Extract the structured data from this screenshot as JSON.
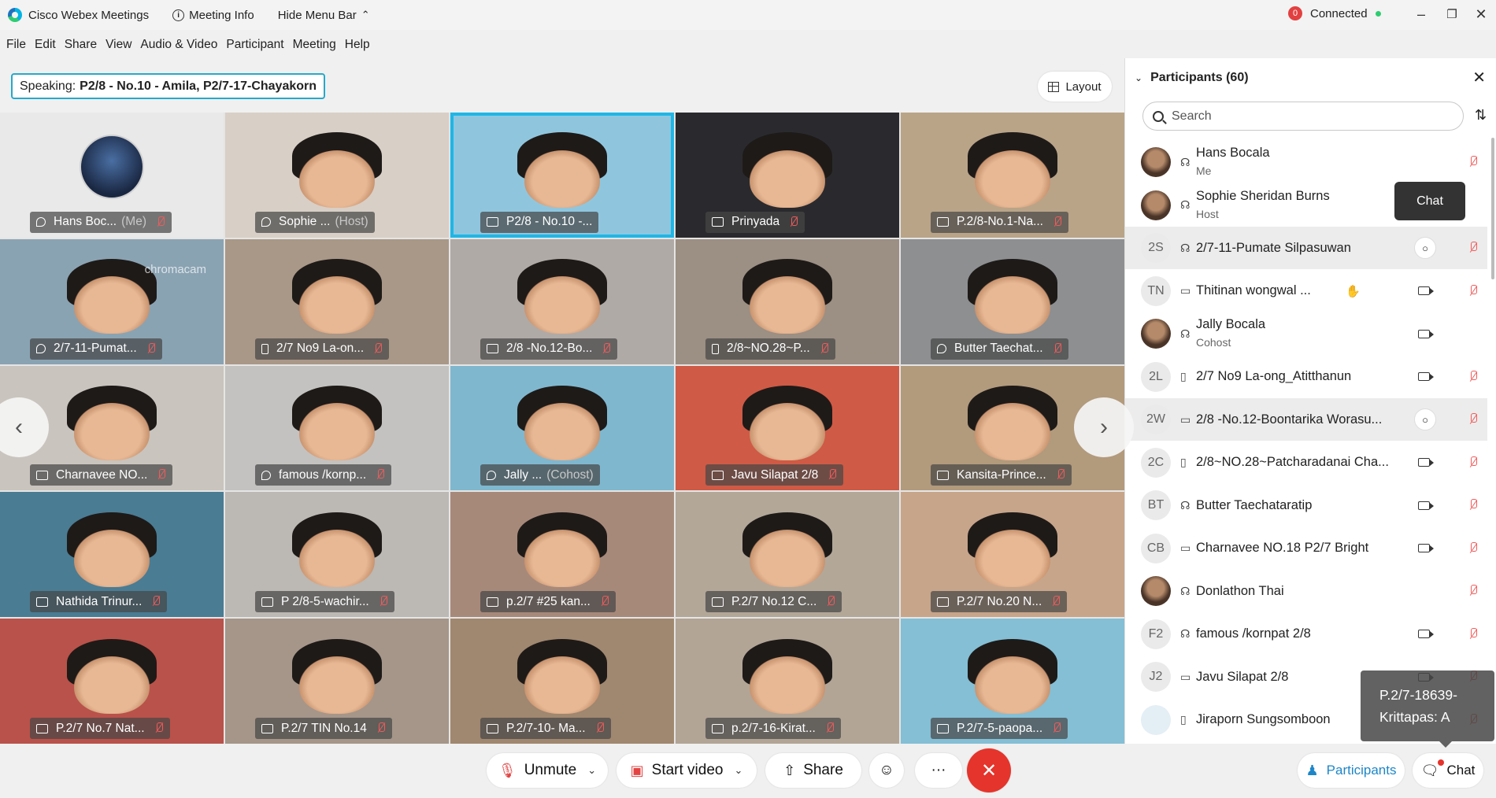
{
  "titlebar": {
    "app_name": "Cisco Webex Meetings",
    "meeting_info": "Meeting Info",
    "hide_menu": "Hide Menu Bar",
    "status_badge": "0",
    "status_text": "Connected"
  },
  "menu": [
    "File",
    "Edit",
    "Share",
    "View",
    "Audio & Video",
    "Participant",
    "Meeting",
    "Help"
  ],
  "speaking": {
    "prefix": "Speaking:",
    "names": "P2/8 - No.10 - Amila, P2/7-17-Chayakorn"
  },
  "layout_label": "Layout",
  "tiles": [
    {
      "label": "Hans Boc...",
      "role": "(Me)",
      "icon": "audio",
      "muted": true,
      "bg": "#e9e9e9",
      "avatar": true
    },
    {
      "label": "Sophie ...",
      "role": "(Host)",
      "icon": "audio",
      "muted": false,
      "bg": "#d8cfc6"
    },
    {
      "label": "P2/8 - No.10 -...",
      "role": "",
      "icon": "video",
      "muted": false,
      "bg": "#8fc6de",
      "active": true
    },
    {
      "label": "Prinyada",
      "role": "",
      "icon": "video",
      "muted": true,
      "bg": "#2a2a2e"
    },
    {
      "label": "P.2/8-No.1-Na...",
      "role": "",
      "icon": "video",
      "muted": true,
      "bg": "#b9a488"
    },
    {
      "label": "2/7-11-Pumat...",
      "role": "",
      "icon": "audio",
      "muted": true,
      "bg": "#8aa3b3",
      "cc": "chromacam"
    },
    {
      "label": "2/7 No9 La-on...",
      "role": "",
      "icon": "phone",
      "muted": true,
      "bg": "#a99787"
    },
    {
      "label": "2/8 -No.12-Bo...",
      "role": "",
      "icon": "video",
      "muted": true,
      "bg": "#b0aaa6"
    },
    {
      "label": "2/8~NO.28~P...",
      "role": "",
      "icon": "phone",
      "muted": true,
      "bg": "#9c8f83"
    },
    {
      "label": "Butter Taechat...",
      "role": "",
      "icon": "audio",
      "muted": true,
      "bg": "#8d8f91"
    },
    {
      "label": "Charnavee NO...",
      "role": "",
      "icon": "video",
      "muted": true,
      "bg": "#c9c4bd"
    },
    {
      "label": "famous /kornp...",
      "role": "",
      "icon": "audio",
      "muted": true,
      "bg": "#c3c2c0"
    },
    {
      "label": "Jally ...",
      "role": "(Cohost)",
      "icon": "audio",
      "muted": false,
      "bg": "#7fb7cf"
    },
    {
      "label": "Javu Silapat 2/8",
      "role": "",
      "icon": "video",
      "muted": true,
      "bg": "#cf5a45"
    },
    {
      "label": "Kansita-Prince...",
      "role": "",
      "icon": "video",
      "muted": true,
      "bg": "#b29a7c"
    },
    {
      "label": "Nathida Trinur...",
      "role": "",
      "icon": "video",
      "muted": true,
      "bg": "#4a7c93"
    },
    {
      "label": "P 2/8-5-wachir...",
      "role": "",
      "icon": "video",
      "muted": true,
      "bg": "#bcb8b3"
    },
    {
      "label": "p.2/7 #25 kan...",
      "role": "",
      "icon": "video",
      "muted": true,
      "bg": "#a7897a"
    },
    {
      "label": "P.2/7 No.12 C...",
      "role": "",
      "icon": "video",
      "muted": true,
      "bg": "#b3a798"
    },
    {
      "label": "P.2/7 No.20 N...",
      "role": "",
      "icon": "video",
      "muted": true,
      "bg": "#c7a58a"
    },
    {
      "label": "P.2/7 No.7 Nat...",
      "role": "",
      "icon": "video",
      "muted": true,
      "bg": "#b9524a"
    },
    {
      "label": "P.2/7 TIN No.14",
      "role": "",
      "icon": "video",
      "muted": true,
      "bg": "#a59689"
    },
    {
      "label": "P.2/7-10- Ma...",
      "role": "",
      "icon": "video",
      "muted": true,
      "bg": "#a0876f"
    },
    {
      "label": "p.2/7-16-Kirat...",
      "role": "",
      "icon": "video",
      "muted": true,
      "bg": "#b2a596"
    },
    {
      "label": "P.2/7-5-paopa...",
      "role": "",
      "icon": "video",
      "muted": true,
      "bg": "#84bfd5"
    }
  ],
  "toolbar": {
    "unmute": "Unmute",
    "start_video": "Start video",
    "share": "Share",
    "more": "···",
    "participants": "Participants",
    "chat": "Chat"
  },
  "panel": {
    "title": "Participants (60)",
    "search_placeholder": "Search",
    "participants": [
      {
        "initials": "",
        "photo": true,
        "name": "Hans Bocala",
        "role": "Me",
        "device": "audio",
        "video": false,
        "muted": true
      },
      {
        "initials": "",
        "photo": true,
        "name": "Sophie Sheridan Burns",
        "role": "Host",
        "device": "audio",
        "video": false,
        "muted": false
      },
      {
        "initials": "2S",
        "name": "2/7-11-Pumate Silpasuwan",
        "device": "audio",
        "chat": true,
        "muted": true,
        "hl": true
      },
      {
        "initials": "TN",
        "name": "Thitinan wongwal ...",
        "device": "video",
        "hand": true,
        "video": true,
        "muted": true
      },
      {
        "initials": "",
        "photo": true,
        "name": "Jally Bocala",
        "role": "Cohost",
        "device": "audio",
        "video": true,
        "muted": false
      },
      {
        "initials": "2L",
        "name": "2/7 No9 La-ong_Atitthanun",
        "device": "phone",
        "video": true,
        "muted": true
      },
      {
        "initials": "2W",
        "name": "2/8 -No.12-Boontarika Worasu...",
        "device": "video",
        "chat": true,
        "muted": true,
        "hl": true
      },
      {
        "initials": "2C",
        "name": "2/8~NO.28~Patcharadanai Cha...",
        "device": "phone",
        "video": true,
        "muted": true
      },
      {
        "initials": "BT",
        "name": "Butter Taechataratip",
        "device": "audio",
        "video": true,
        "muted": true
      },
      {
        "initials": "CB",
        "name": "Charnavee NO.18 P2/7 Bright",
        "device": "video",
        "video": true,
        "muted": true
      },
      {
        "initials": "",
        "photo": true,
        "name": "Donlathon Thai",
        "device": "audio",
        "video": false,
        "muted": true
      },
      {
        "initials": "F2",
        "name": "famous /kornpat 2/8",
        "device": "audio",
        "video": true,
        "muted": true
      },
      {
        "initials": "J2",
        "name": "Javu Silapat 2/8",
        "device": "video",
        "video": true,
        "muted": true
      },
      {
        "initials": "",
        "pale": true,
        "name": "Jiraporn Sungsomboon",
        "device": "phone",
        "video": false,
        "muted": true
      }
    ]
  },
  "chat_tooltip": "Chat",
  "name_tooltip": [
    "P.2/7-18639-",
    "Krittapas: A"
  ]
}
